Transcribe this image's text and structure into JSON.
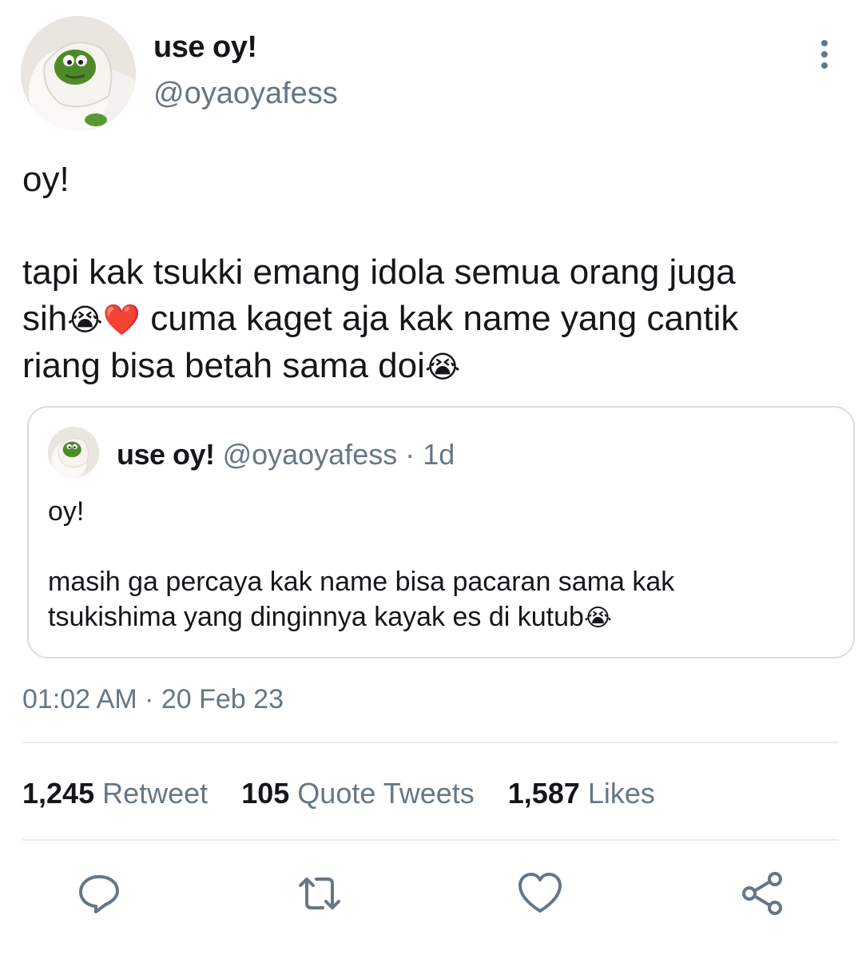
{
  "author": {
    "name": "use oy!",
    "handle": "@oyaoyafess"
  },
  "tweet": {
    "line1": "oy!",
    "line2": "tapi kak tsukki emang idola semua orang juga",
    "line3a": "sih",
    "line3b": "cuma kaget aja kak name yang cantik",
    "line4": "riang bisa betah sama doi",
    "emoji_cry": "😭",
    "emoji_heart": "❤️"
  },
  "quote": {
    "name": "use oy!",
    "handle": "@oyaoyafess",
    "separator": "·",
    "time": "1d",
    "line1": "oy!",
    "line2": "masih ga percaya kak name bisa pacaran sama kak",
    "line3": "tsukishima yang dinginnya kayak es di kutub",
    "emoji_cry": "😭"
  },
  "timestamp": "01:02 AM · 20 Feb 23",
  "stats": {
    "retweets_count": "1,245",
    "retweets_label": "Retweet",
    "quotes_count": "105",
    "quotes_label": "Quote Tweets",
    "likes_count": "1,587",
    "likes_label": "Likes"
  },
  "icons": {
    "more": "more-vertical-icon",
    "reply": "reply-icon",
    "retweet": "retweet-icon",
    "like": "heart-icon",
    "share": "share-icon"
  },
  "colors": {
    "text": "#14171a",
    "secondary": "#657786",
    "border": "#d9dee2",
    "divider": "#e6ecf0"
  }
}
